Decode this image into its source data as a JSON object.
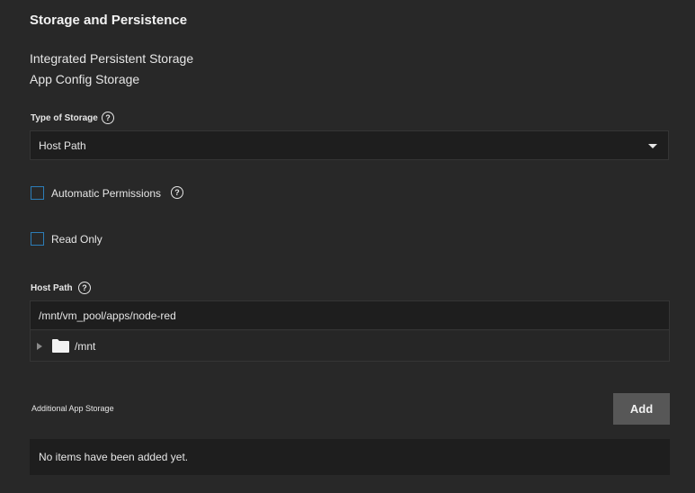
{
  "section": {
    "title": "Storage and Persistence",
    "sub_items": [
      "Integrated Persistent Storage",
      "App Config Storage"
    ]
  },
  "type_of_storage": {
    "label": "Type of Storage",
    "help_icon": "help-circle-icon",
    "selected": "Host Path",
    "dropdown_icon": "caret-down-icon"
  },
  "automatic_permissions": {
    "label": "Automatic Permissions",
    "checked": false,
    "help_icon": "help-circle-icon"
  },
  "read_only": {
    "label": "Read Only",
    "checked": false
  },
  "host_path": {
    "label": "Host Path",
    "help_icon": "help-circle-icon",
    "value": "/mnt/vm_pool/apps/node-red",
    "tree": [
      {
        "label": "/mnt",
        "icon": "folder-icon",
        "expanded": false
      }
    ]
  },
  "additional_storage": {
    "label": "Additional App Storage",
    "add_label": "Add",
    "empty_text": "No items have been added yet."
  },
  "colors": {
    "background": "#282828",
    "input_background": "#1e1e1e",
    "checkbox_border": "#2c7db8",
    "button_background": "#575757",
    "text": "#e6e6e6"
  }
}
